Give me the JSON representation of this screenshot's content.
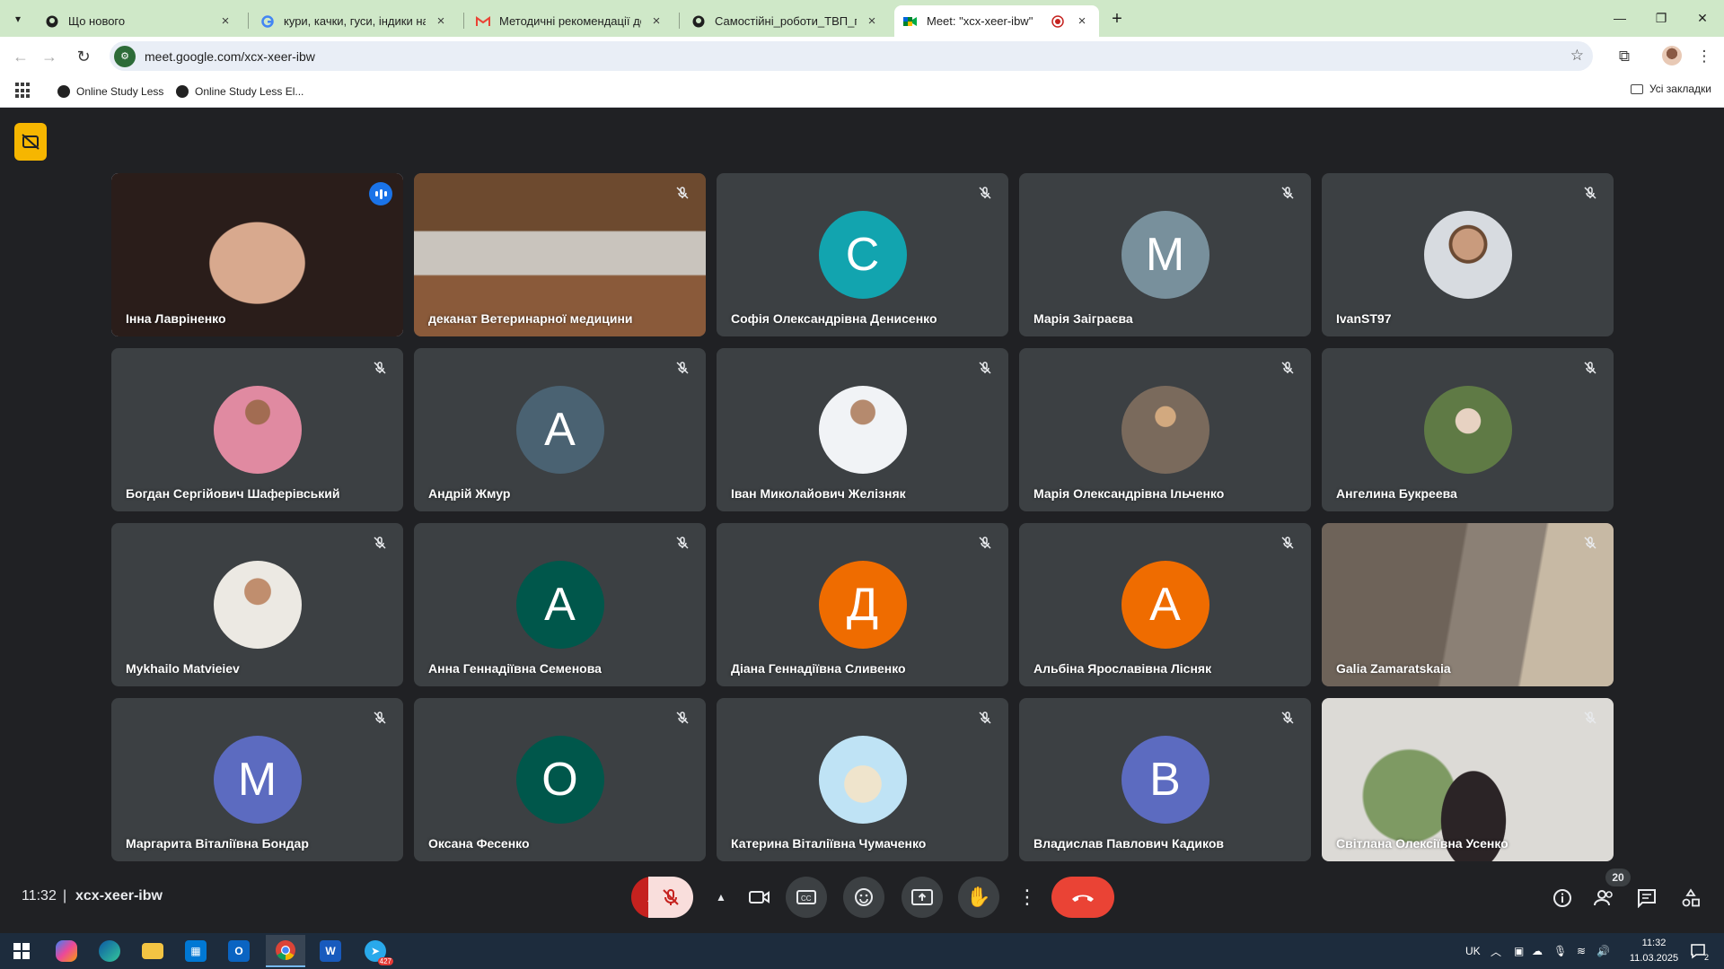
{
  "browser": {
    "tabs": [
      {
        "label": "Що нового",
        "icon": "github-icon",
        "active": false
      },
      {
        "label": "кури, качки, гуси, індики на бі",
        "icon": "google-icon",
        "active": false
      },
      {
        "label": "Методичні рекомендації до ві",
        "icon": "gmail-icon",
        "active": false
      },
      {
        "label": "Самостійні_роботи_ТВП_птахі",
        "icon": "github-icon",
        "active": false
      },
      {
        "label": "Meet: \"xcx-xeer-ibw\"",
        "icon": "meet-icon",
        "active": true
      }
    ],
    "url": "meet.google.com/xcx-xeer-ibw",
    "bookmarks": [
      {
        "label": "Online Study Less"
      },
      {
        "label": "Online Study Less El..."
      }
    ],
    "all_bookmarks_label": "Усі закладки"
  },
  "meeting": {
    "time": "11:32",
    "separator": "|",
    "code": "xcx-xeer-ibw",
    "people_count": "20",
    "participants": [
      {
        "name": "Інна Лавріненко",
        "type": "video",
        "speaking": true
      },
      {
        "name": "деканат Ветеринарної медицини",
        "type": "video",
        "muted": true
      },
      {
        "name": "Софія Олександрівна Денисенко",
        "type": "letter",
        "letter": "С",
        "color": "#12a4af",
        "muted": true
      },
      {
        "name": "Марія Заіграєва",
        "type": "letter",
        "letter": "М",
        "color": "#78909c",
        "muted": true
      },
      {
        "name": "IvanST97",
        "type": "photo",
        "muted": true
      },
      {
        "name": "Богдан Сергійович Шаферівський",
        "type": "photo",
        "muted": true
      },
      {
        "name": "Андрій Жмур",
        "type": "letter",
        "letter": "А",
        "color": "#4a6272",
        "muted": true
      },
      {
        "name": "Іван Миколайович Желізняк",
        "type": "photo",
        "muted": true
      },
      {
        "name": "Марія Олександрівна Ільченко",
        "type": "photo",
        "muted": true
      },
      {
        "name": "Ангелина Букреева",
        "type": "photo",
        "muted": true
      },
      {
        "name": "Mykhailo Matvieiev",
        "type": "photo",
        "muted": true
      },
      {
        "name": "Анна Геннадіївна Семенова",
        "type": "letter",
        "letter": "А",
        "color": "#00574b",
        "muted": true
      },
      {
        "name": "Діана Геннадіївна Сливенко",
        "type": "letter",
        "letter": "Д",
        "color": "#ef6c00",
        "muted": true
      },
      {
        "name": "Альбіна Ярославівна Лісняк",
        "type": "letter",
        "letter": "А",
        "color": "#ef6c00",
        "muted": true
      },
      {
        "name": "Galia Zamaratskaia",
        "type": "video",
        "muted": true
      },
      {
        "name": "Маргарита Віталіївна Бондар",
        "type": "letter",
        "letter": "М",
        "color": "#5c6bc0",
        "muted": true
      },
      {
        "name": "Оксана Фесенко",
        "type": "letter",
        "letter": "О",
        "color": "#00574b",
        "muted": true
      },
      {
        "name": "Катерина Віталіївна Чумаченко",
        "type": "photo",
        "muted": true
      },
      {
        "name": "Владислав Павлович Кадиков",
        "type": "letter",
        "letter": "В",
        "color": "#5c6bc0",
        "muted": true
      },
      {
        "name": "Світлана Олексіївна Усенко",
        "type": "video",
        "muted": true
      }
    ]
  },
  "taskbar": {
    "language": "UK",
    "time": "11:32",
    "date": "11.03.2025",
    "telegram_badge": "427",
    "notification_count": "2"
  }
}
